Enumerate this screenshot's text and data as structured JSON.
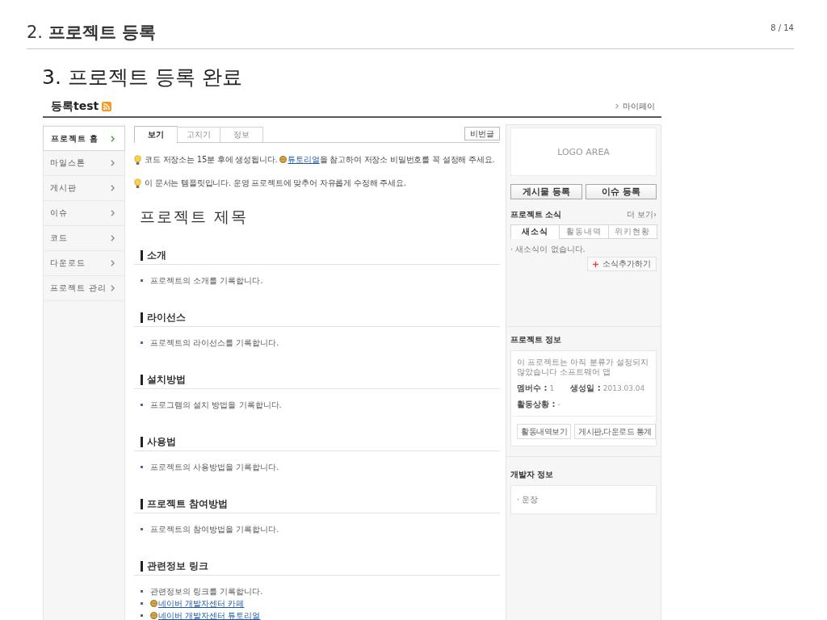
{
  "slide": {
    "heading": "2. **프로젝트 등록**",
    "page_number": "8 / 14",
    "subheading": "3. 프로젝트 등록 완료"
  },
  "screenshot": {
    "header": {
      "title": "등록test",
      "top_link": "마이페이"
    },
    "sidebar": {
      "items": [
        {
          "label": "프로젝트 홈",
          "selected": true
        },
        {
          "label": "마일스톤",
          "selected": false
        },
        {
          "label": "게시판",
          "selected": false
        },
        {
          "label": "이슈",
          "selected": false
        },
        {
          "label": "코드",
          "selected": false
        },
        {
          "label": "다운로드",
          "selected": false
        },
        {
          "label": "프로젝트 관리",
          "selected": false
        }
      ]
    },
    "content": {
      "tabs": [
        {
          "label": "보기",
          "selected": true
        },
        {
          "label": "고치기",
          "selected": false
        },
        {
          "label": "정보",
          "selected": false
        }
      ],
      "tool_button": "비번글",
      "notices": [
        {
          "text": "코드 저장소는 15분 후에 생성됩니다. ",
          "link": "튜토리얼",
          "after": "을 참고하여 저장소 비밀번호를 꼭 설정해 주세요."
        },
        {
          "text": "이 문서는 템플릿입니다. 운영 프로젝트에 맞추어 자유롭게 수정해 주세요."
        }
      ],
      "document_title": "프로젝트 제목",
      "sections": [
        {
          "heading": "소개",
          "items": [
            {
              "kind": "text",
              "text": "프로젝트의 소개를 기록합니다."
            }
          ]
        },
        {
          "heading": "라이선스",
          "items": [
            {
              "kind": "text",
              "text": "프로젝트의 라이선스를 기록합니다."
            }
          ]
        },
        {
          "heading": "설치방법",
          "items": [
            {
              "kind": "text",
              "text": "프로그램의 설치 방법을 기록합니다."
            }
          ]
        },
        {
          "heading": "사용법",
          "items": [
            {
              "kind": "text",
              "text": "프로젝트의 사용방법을 기록합니다."
            }
          ]
        },
        {
          "heading": "프로젝트 참여방법",
          "items": [
            {
              "kind": "text",
              "text": "프로젝트의 참여방법을 기록합니다."
            }
          ]
        },
        {
          "heading": "관련정보 링크",
          "items": [
            {
              "kind": "text",
              "text": "관련정보의 링크를 기록합니다."
            },
            {
              "kind": "link",
              "text": "네이버 개발자센터 카페"
            },
            {
              "kind": "link",
              "text": "네이버 개발자센터 튜토리얼"
            }
          ]
        }
      ]
    },
    "side_panel": {
      "logo": "LOGO AREA",
      "buttons": [
        "게시물 등록",
        "이슈 등록"
      ],
      "news": {
        "title": "프로젝트 소식",
        "more": "더 보기›",
        "tabs": [
          {
            "label": "새소식",
            "selected": true
          },
          {
            "label": "활동내역",
            "selected": false
          },
          {
            "label": "위키현황",
            "selected": false
          }
        ],
        "empty_message": "· 새소식이 없습니다.",
        "add_button": "소식추가하기"
      },
      "info": {
        "title": "프로젝트 정보",
        "description": "이 프로젝트는 아직 분류가 설정되지 않았습니다 소프트웨어 앱",
        "rows": [
          {
            "fields": [
              {
                "label": "멤버수 :",
                "value": "1"
              },
              {
                "label": "생성일 :",
                "value": "2013.03.04"
              }
            ]
          },
          {
            "fields": [
              {
                "label": "활동상황 :",
                "value": "-"
              }
            ]
          }
        ],
        "buttons": [
          "활동내역보기",
          "게시판,다운로드 통계"
        ]
      },
      "developers": {
        "title": "개발자 정보",
        "members": [
          "· 운장"
        ]
      }
    }
  }
}
